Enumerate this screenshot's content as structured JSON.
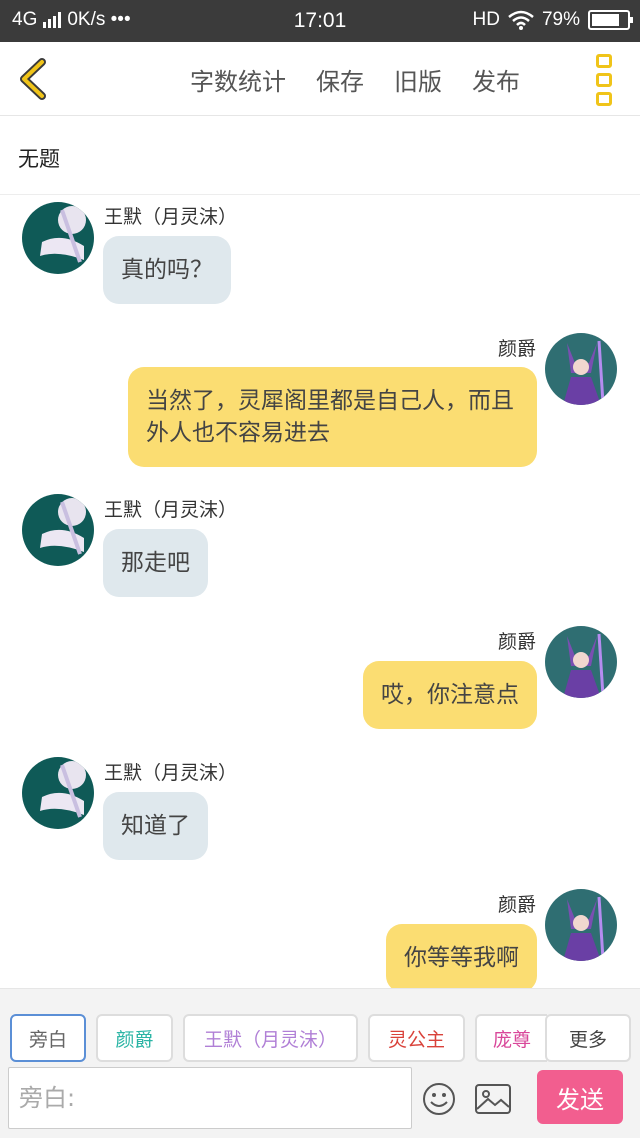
{
  "status_bar": {
    "network": "4G",
    "speed": "0K/s •••",
    "time": "17:01",
    "hd": "HD",
    "battery": "79%",
    "battery_level": 0.79
  },
  "toolbar": {
    "actions": [
      "字数统计",
      "保存",
      "旧版",
      "发布"
    ],
    "accent_color": "#f0c419"
  },
  "document": {
    "title": "无题"
  },
  "messages": [
    {
      "sender": "王默（月灵沫）",
      "text": "真的吗？",
      "side": "left"
    },
    {
      "sender": "颜爵",
      "text": "当然了，灵犀阁里都是自己人，而且外人也不容易进去",
      "side": "right"
    },
    {
      "sender": "王默（月灵沫）",
      "text": "那走吧",
      "side": "left"
    },
    {
      "sender": "颜爵",
      "text": "哎，你注意点",
      "side": "right"
    },
    {
      "sender": "王默（月灵沫）",
      "text": "知道了",
      "side": "left"
    },
    {
      "sender": "颜爵",
      "text": "你等等我啊",
      "side": "right"
    }
  ],
  "characters": [
    {
      "label": "旁白",
      "color": "#666666"
    },
    {
      "label": "颜爵",
      "color": "#2bb5a5"
    },
    {
      "label": "王默（月灵沫）",
      "color": "#b07fd6"
    },
    {
      "label": "灵公主",
      "color": "#d9423a"
    },
    {
      "label": "庞尊",
      "color": "#d9479a"
    },
    {
      "label": "更多",
      "color": "#444444"
    }
  ],
  "input": {
    "placeholder": "旁白:"
  },
  "send_label": "发送",
  "colors": {
    "left_bubble": "#dfe8ed",
    "right_bubble": "#fbdd72",
    "send_button": "#f25e8f"
  }
}
